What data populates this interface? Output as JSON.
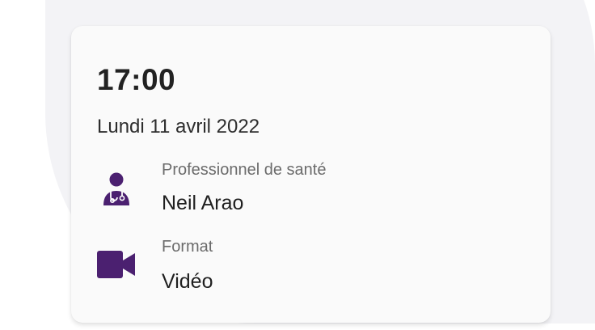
{
  "appointment": {
    "time": "17:00",
    "date": "Lundi 11 avril 2022",
    "professional": {
      "label": "Professionnel de santé",
      "value": "Neil Arao",
      "icon": "doctor-icon"
    },
    "format": {
      "label": "Format",
      "value": "Vidéo",
      "icon": "video-camera-icon"
    }
  },
  "colors": {
    "accent": "#4b2070",
    "card_background": "#fafafa",
    "page_blob": "#f3f3f6"
  }
}
